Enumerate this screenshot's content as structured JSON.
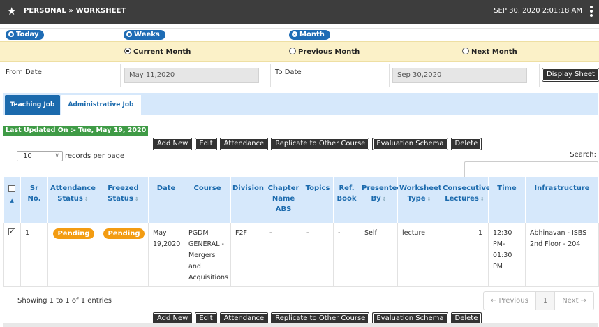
{
  "header": {
    "breadcrumb": "PERSONAL » WORKSHEET",
    "datetime": "SEP 30, 2020  2:01:18 AM",
    "star_icon": "star-icon",
    "menu_icon": "vertical-dots-icon"
  },
  "period_pills": {
    "today": "Today",
    "weeks": "Weeks",
    "month": "Month",
    "selected": "Month"
  },
  "month_options": {
    "current": "Current Month",
    "previous": "Previous Month",
    "next": "Next Month",
    "selected": "Current Month"
  },
  "date_range": {
    "from_label": "From Date",
    "from_value": "May 11,2020",
    "to_label": "To Date",
    "to_value": "Sep 30,2020",
    "display_button": "Display Sheet"
  },
  "tabs": {
    "teaching": "Teaching Job",
    "administrative": "Administrative Job",
    "active": "Teaching Job"
  },
  "last_updated": "Last Updated On :- Tue, May 19, 2020",
  "actions": {
    "add_new": "Add New",
    "edit": "Edit",
    "attendance": "Attendance",
    "replicate": "Replicate to Other Course",
    "evaluation": "Evaluation Schema",
    "delete": "Delete"
  },
  "table_controls": {
    "page_length": "10",
    "records_per_page": "records per page",
    "search_label": "Search:",
    "search_value": ""
  },
  "table": {
    "columns": [
      {
        "key": "select",
        "label": ""
      },
      {
        "key": "sr",
        "label": "Sr No."
      },
      {
        "key": "attendance_status",
        "label": "Attendance Status"
      },
      {
        "key": "freezed_status",
        "label": "Freezed Status"
      },
      {
        "key": "date",
        "label": "Date"
      },
      {
        "key": "course",
        "label": "Course"
      },
      {
        "key": "division",
        "label": "Division"
      },
      {
        "key": "chapter",
        "label": "Chapter Name ABS"
      },
      {
        "key": "topics",
        "label": "Topics"
      },
      {
        "key": "ref_book",
        "label": "Ref. Book"
      },
      {
        "key": "presented_by",
        "label": "Presented By"
      },
      {
        "key": "worksheet_type",
        "label": "Worksheet Type"
      },
      {
        "key": "consecutive",
        "label": "Consecutive Lectures"
      },
      {
        "key": "time",
        "label": "Time"
      },
      {
        "key": "infrastructure",
        "label": "Infrastructure"
      }
    ],
    "rows": [
      {
        "checked": true,
        "sr": "1",
        "attendance_status": "Pending",
        "freezed_status": "Pending",
        "date": "May 19,2020",
        "course": "PGDM GENERAL - Mergers and Acquisitions",
        "division": "F2F",
        "chapter": "-",
        "topics": "-",
        "ref_book": "-",
        "presented_by": "Self",
        "worksheet_type": "lecture",
        "consecutive": "1",
        "time": "12:30 PM-01:30 PM",
        "infrastructure": "Abhinavan - ISBS 2nd Floor - 204"
      }
    ]
  },
  "footer": {
    "showing": "Showing 1 to 1 of 1 entries",
    "prev": "← Previous",
    "page": "1",
    "next": "Next →"
  },
  "colors": {
    "topbar": "#3d3d3d",
    "accent_blue": "#1b6aad",
    "header_bg": "#d6e8fb",
    "month_row_bg": "#fbf1c8",
    "updated_green": "#3f9b46",
    "pending_orange": "#f39c12"
  }
}
